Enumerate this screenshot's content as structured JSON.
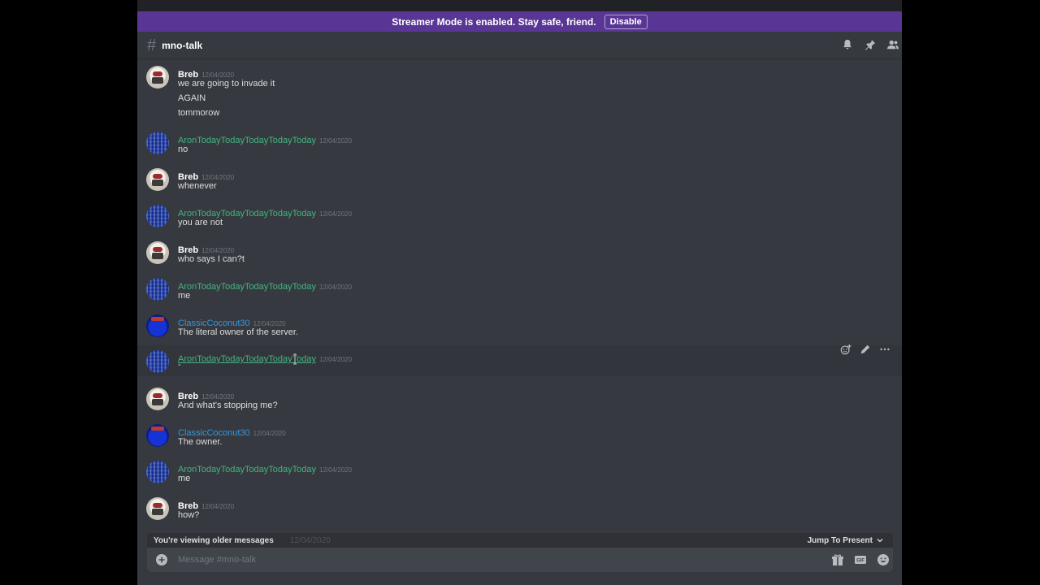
{
  "banner": {
    "text": "Streamer Mode is enabled. Stay safe, friend.",
    "button": "Disable"
  },
  "channel": {
    "hash": "#",
    "name": "mno-talk"
  },
  "header_icons": [
    "bell-icon",
    "pin-icon",
    "members-icon"
  ],
  "messages": [
    {
      "user": "Breb",
      "time": "12/04/2020",
      "lines": [
        "we are going to invade it",
        "AGAIN",
        "tommorow"
      ]
    },
    {
      "user": "AronTodayTodayTodayTodayToday",
      "time": "12/04/2020",
      "lines": [
        "no"
      ]
    },
    {
      "user": "Breb",
      "time": "12/04/2020",
      "lines": [
        "whenever"
      ]
    },
    {
      "user": "AronTodayTodayTodayTodayToday",
      "time": "12/04/2020",
      "lines": [
        "you are not"
      ]
    },
    {
      "user": "Breb",
      "time": "12/04/2020",
      "lines": [
        "who says I can?t"
      ]
    },
    {
      "user": "AronTodayTodayTodayTodayToday",
      "time": "12/04/2020",
      "lines": [
        "me"
      ]
    },
    {
      "user": "ClassicCoconut30",
      "time": "12/04/2020",
      "lines": [
        "The literal owner of the server."
      ]
    },
    {
      "user": "AronTodayTodayTodayTodayToday",
      "time": "12/04/2020",
      "lines": [
        "-"
      ]
    },
    {
      "user": "Breb",
      "time": "12/04/2020",
      "lines": [
        "And what's stopping me?"
      ]
    },
    {
      "user": "ClassicCoconut30",
      "time": "12/04/2020",
      "lines": [
        "The owner."
      ]
    },
    {
      "user": "AronTodayTodayTodayTodayToday",
      "time": "12/04/2020",
      "lines": [
        "me"
      ]
    },
    {
      "user": "Breb",
      "time": "12/04/2020",
      "lines": [
        "how?"
      ]
    }
  ],
  "hover_actions": [
    "add-reaction-icon",
    "edit-icon",
    "more-icon"
  ],
  "older_bar": {
    "text": "You're viewing older messages",
    "ghost_text": "12/04/2020",
    "jump": "Jump To Present"
  },
  "composer": {
    "placeholder": "Message #mno-talk",
    "icons": [
      "gift-icon",
      "gif-icon",
      "emoji-icon"
    ]
  },
  "colors": {
    "streamer_bar": "#593695",
    "background": "#36393f",
    "aron_name": "#43b581",
    "classic_name": "#3498db"
  }
}
